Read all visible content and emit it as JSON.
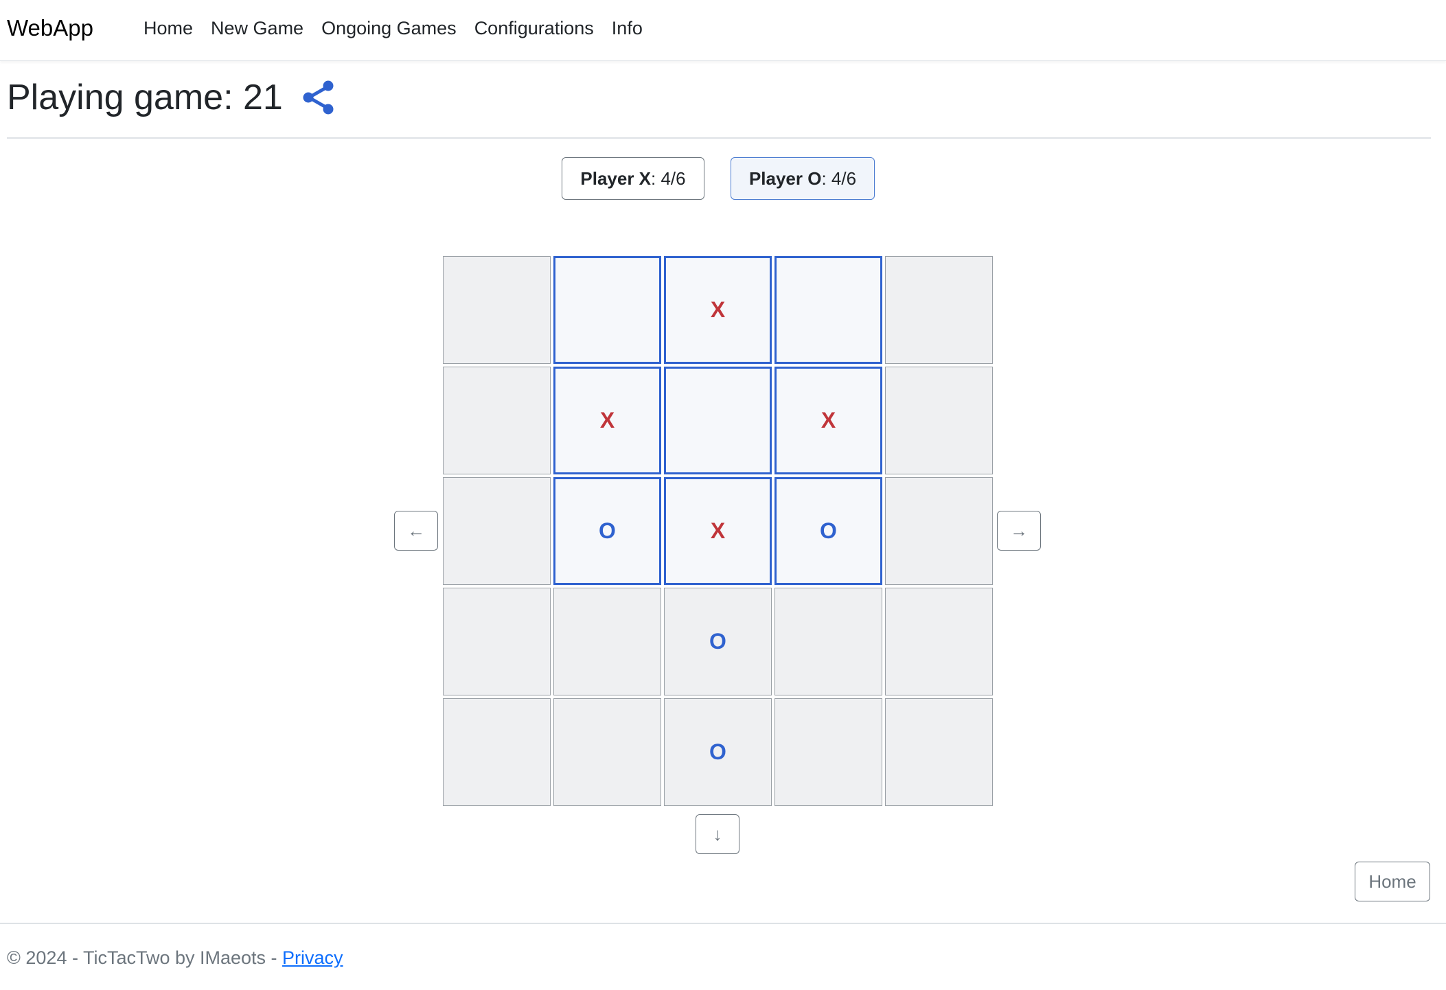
{
  "navbar": {
    "brand": "WebApp",
    "links": [
      "Home",
      "New Game",
      "Ongoing Games",
      "Configurations",
      "Info"
    ]
  },
  "page": {
    "title": "Playing game: 21",
    "share_icon": "share-icon"
  },
  "players": {
    "x": {
      "name": "Player X",
      "sep": ": ",
      "count": "4/6"
    },
    "o": {
      "name": "Player O",
      "sep": ": ",
      "count": "4/6"
    }
  },
  "board": {
    "cells": [
      [
        "",
        "",
        "X",
        "",
        ""
      ],
      [
        "",
        "X",
        "",
        "X",
        ""
      ],
      [
        "",
        "O",
        "X",
        "O",
        ""
      ],
      [
        "",
        "",
        "O",
        "",
        ""
      ],
      [
        "",
        "",
        "O",
        "",
        ""
      ]
    ],
    "active_area": {
      "row_start": 0,
      "row_end": 2,
      "col_start": 1,
      "col_end": 3
    },
    "colors": {
      "x": "#c0353a",
      "o": "#2f62cf",
      "active_border": "#2f62cf"
    }
  },
  "controls": {
    "left": "←",
    "right": "→",
    "down": "↓",
    "home": "Home"
  },
  "footer": {
    "text": "© 2024 - TicTacTwo by IMaeots - ",
    "link": "Privacy"
  }
}
